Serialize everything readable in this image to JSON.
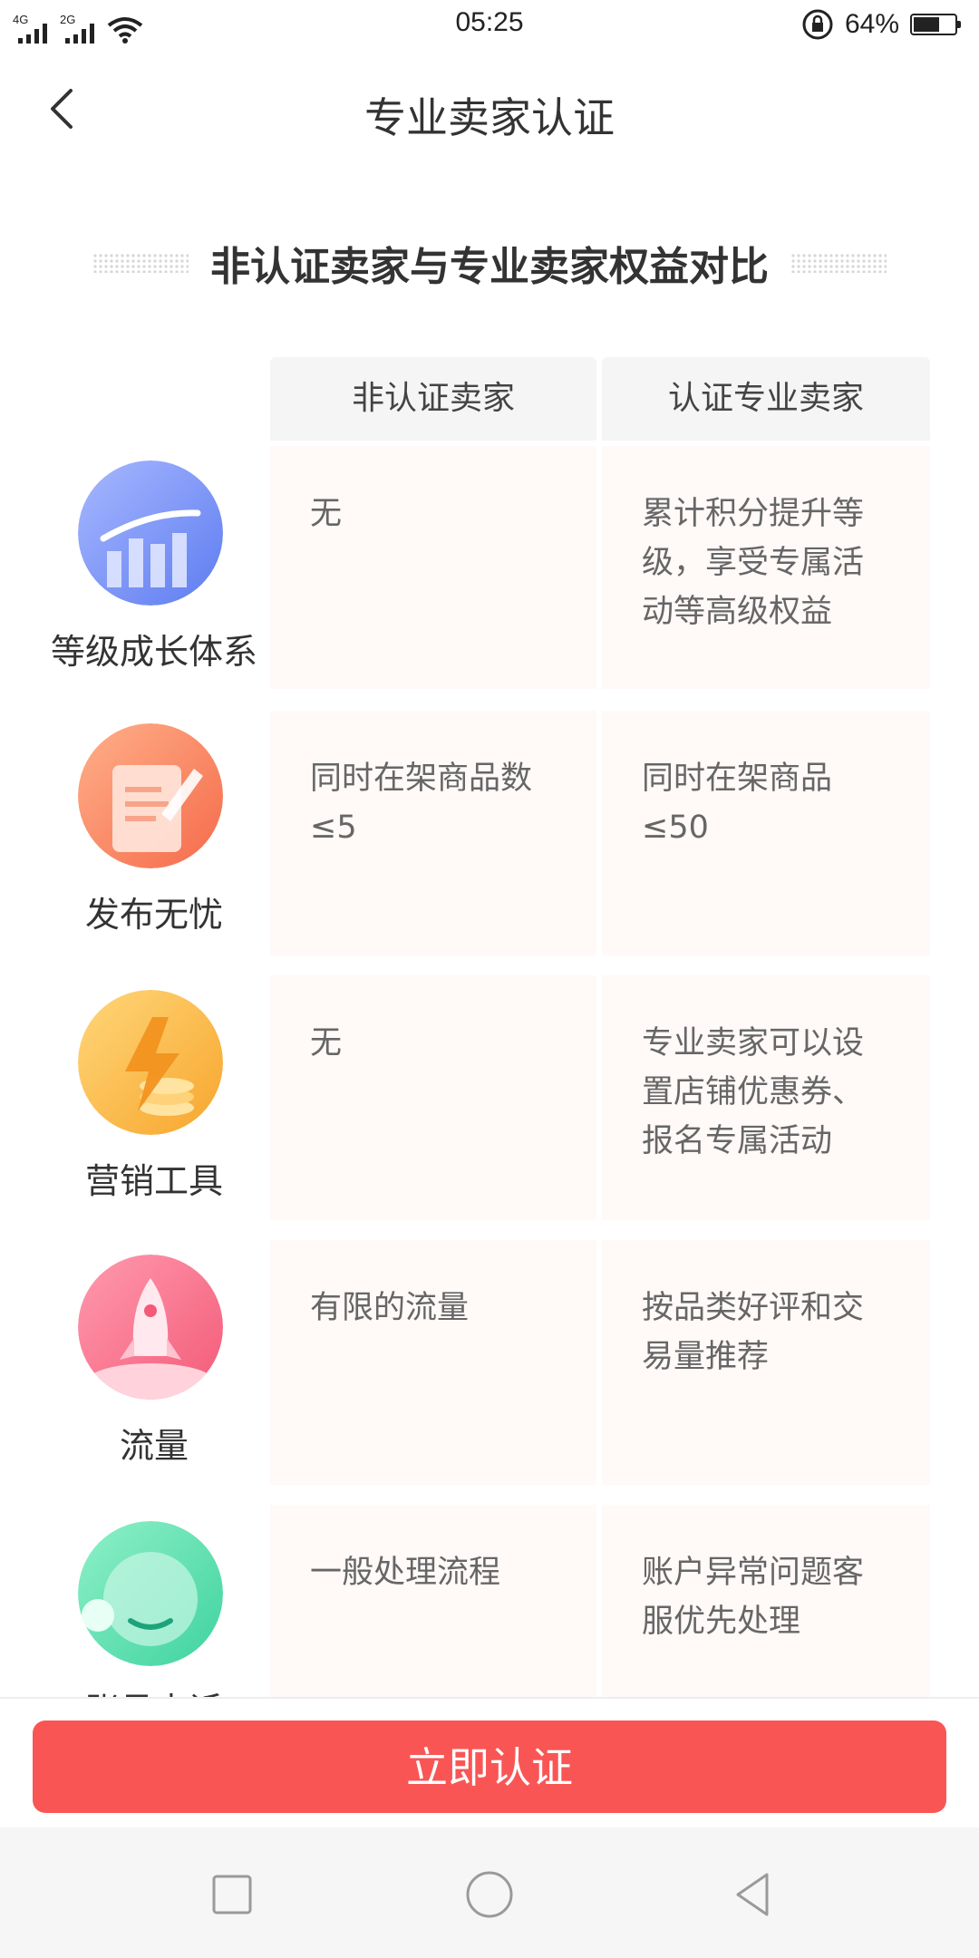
{
  "status_bar": {
    "net1": "4G",
    "net2": "2G",
    "time": "05:25",
    "battery_pct": "64%",
    "battery_level": 0.64
  },
  "header": {
    "title": "专业卖家认证"
  },
  "section": {
    "title": "非认证卖家与专业卖家权益对比"
  },
  "table": {
    "col1": "非认证卖家",
    "col2": "认证专业卖家",
    "rows": [
      {
        "label": "等级成长体系",
        "icon": "growth-chart-icon",
        "c1": "无",
        "c2": "累计积分提升等级，享受专属活动等高级权益"
      },
      {
        "label": "发布无忧",
        "icon": "document-pen-icon",
        "c1": "同时在架商品数≤5",
        "c2": "同时在架商品≤50"
      },
      {
        "label": "营销工具",
        "icon": "lightning-coins-icon",
        "c1": "无",
        "c2": "专业卖家可以设置店铺优惠券、报名专属活动"
      },
      {
        "label": "流量",
        "icon": "rocket-icon",
        "c1": "有限的流量",
        "c2": "按品类好评和交易量推荐"
      },
      {
        "label": "账号申诉",
        "icon": "headset-support-icon",
        "c1": "一般处理流程",
        "c2": "账户异常问题客服优先处理"
      }
    ]
  },
  "cta": {
    "label": "立即认证"
  },
  "colors": {
    "accent": "#fa5555",
    "cell_bg": "#fff9f8",
    "header_bg": "#f5f5f5"
  }
}
